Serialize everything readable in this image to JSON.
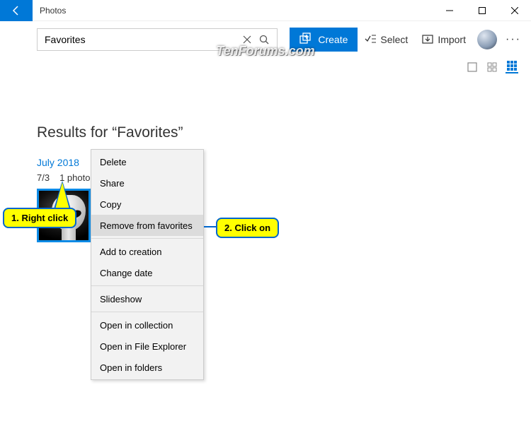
{
  "titlebar": {
    "title": "Photos"
  },
  "toolbar": {
    "search_value": "Favorites",
    "create_label": "Create",
    "select_label": "Select",
    "import_label": "Import"
  },
  "watermark": "TenForums.com",
  "content": {
    "results_prefix": "Results for ",
    "results_query": "“Favorites”",
    "date_heading": "July 2018",
    "date_day": "7/3",
    "date_count": "1 photo"
  },
  "context_menu": {
    "items": [
      {
        "label": "Delete",
        "highlight": false
      },
      {
        "label": "Share",
        "highlight": false
      },
      {
        "label": "Copy",
        "highlight": false
      },
      {
        "label": "Remove from favorites",
        "highlight": true
      },
      {
        "sep": true
      },
      {
        "label": "Add to creation",
        "highlight": false
      },
      {
        "label": "Change date",
        "highlight": false
      },
      {
        "sep": true
      },
      {
        "label": "Slideshow",
        "highlight": false
      },
      {
        "sep": true
      },
      {
        "label": "Open in collection",
        "highlight": false
      },
      {
        "label": "Open in File Explorer",
        "highlight": false
      },
      {
        "label": "Open in folders",
        "highlight": false
      }
    ]
  },
  "callouts": {
    "c1": "1. Right click",
    "c2": "2. Click on"
  }
}
